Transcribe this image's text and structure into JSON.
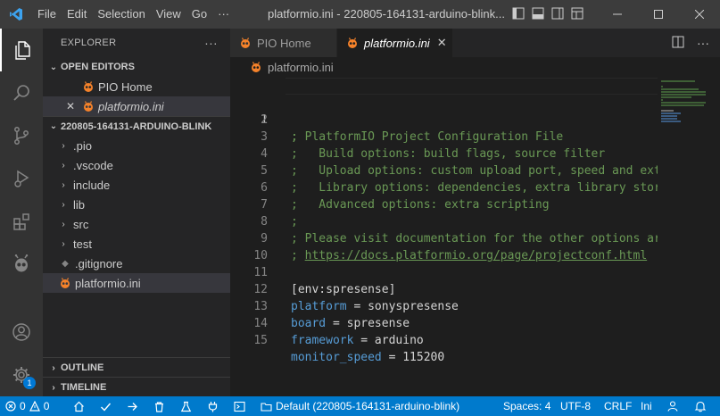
{
  "titlebar": {
    "menu": [
      "File",
      "Edit",
      "Selection",
      "View",
      "Go",
      "···"
    ],
    "title": "platformio.ini - 220805-164131-arduino-blink..."
  },
  "explorer": {
    "title": "EXPLORER",
    "more": "···",
    "open_editors": {
      "label": "OPEN EDITORS",
      "items": [
        {
          "label": "PIO Home"
        },
        {
          "label": "platformio.ini",
          "close": "✕"
        }
      ]
    },
    "workspace": {
      "label": "220805-164131-ARDUINO-BLINK",
      "items": [
        {
          "label": ".pio",
          "kind": "folder"
        },
        {
          "label": ".vscode",
          "kind": "folder"
        },
        {
          "label": "include",
          "kind": "folder"
        },
        {
          "label": "lib",
          "kind": "folder"
        },
        {
          "label": "src",
          "kind": "folder"
        },
        {
          "label": "test",
          "kind": "folder"
        },
        {
          "label": ".gitignore",
          "kind": "file"
        },
        {
          "label": "platformio.ini",
          "kind": "pio"
        }
      ]
    },
    "outline": "OUTLINE",
    "timeline": "TIMELINE"
  },
  "activity": {
    "accounts_badge": "1"
  },
  "tabs": [
    {
      "label": "PIO Home"
    },
    {
      "label": "platformio.ini",
      "close": "✕"
    }
  ],
  "breadcrumb": "platformio.ini",
  "editor": {
    "lines": [
      {
        "n": "1",
        "text": "; PlatformIO Project Configuration File"
      },
      {
        "n": "2",
        "text": ";"
      },
      {
        "n": "3",
        "text": ";   Build options: build flags, source filter"
      },
      {
        "n": "4",
        "text": ";   Upload options: custom upload port, speed and ext"
      },
      {
        "n": "5",
        "text": ";   Library options: dependencies, extra library stor"
      },
      {
        "n": "6",
        "text": ";   Advanced options: extra scripting"
      },
      {
        "n": "7",
        "text": ";"
      },
      {
        "n": "8",
        "text": "; Please visit documentation for the other options ar"
      },
      {
        "n": "9",
        "prefix": "; ",
        "link": "https://docs.platformio.org/page/projectconf.html"
      },
      {
        "n": "10",
        "text": ""
      },
      {
        "n": "11",
        "text": "[env:spresense]"
      },
      {
        "n": "12",
        "key": "platform",
        "value": " = sonyspresense"
      },
      {
        "n": "13",
        "key": "board",
        "value": " = spresense"
      },
      {
        "n": "14",
        "key": "framework",
        "value": " = arduino"
      },
      {
        "n": "15",
        "key": "monitor_speed",
        "value": " = 115200"
      }
    ]
  },
  "statusbar": {
    "errors": "0",
    "warnings": "0",
    "environment": "Default (220805-164131-arduino-blink)",
    "spaces": "Spaces: 4",
    "encoding": "UTF-8",
    "eol": "CRLF",
    "language": "Ini"
  },
  "colors": {
    "statusbar": "#007acc",
    "comment": "#6a9955",
    "keyword": "#569cd6",
    "pio_orange": "#f5822a"
  }
}
